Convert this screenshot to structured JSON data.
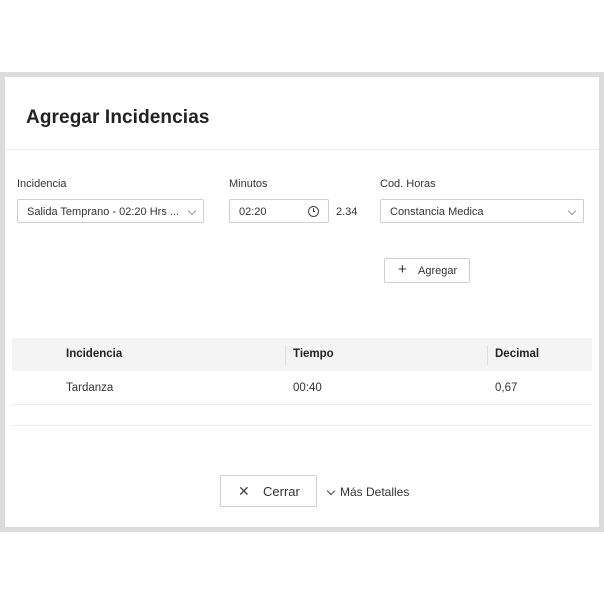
{
  "dialog": {
    "title": "Agregar Incidencias"
  },
  "form": {
    "incidencia": {
      "label": "Incidencia",
      "value": "Salida Temprano - 02:20 Hrs ..."
    },
    "minutos": {
      "label": "Minutos",
      "value": "02:20",
      "decimal": "2.34"
    },
    "cod_horas": {
      "label": "Cod. Horas",
      "value": "Constancia Medica"
    },
    "add_button": "Agregar"
  },
  "table": {
    "columns": [
      "Incidencia",
      "Tiempo",
      "Decimal"
    ],
    "rows": [
      [
        "Tardanza",
        "00:40",
        "0,67"
      ]
    ]
  },
  "footer": {
    "close_label": "Cerrar",
    "more_details_label": "Más Detalles"
  },
  "icons": {
    "incidencia_dropdown": "chevron-down-icon",
    "minutos_clock": "clock-icon",
    "cod_horas_dropdown": "chevron-down-icon",
    "add": "plus-icon",
    "close": "close-icon",
    "more_details": "chevron-down-icon"
  }
}
